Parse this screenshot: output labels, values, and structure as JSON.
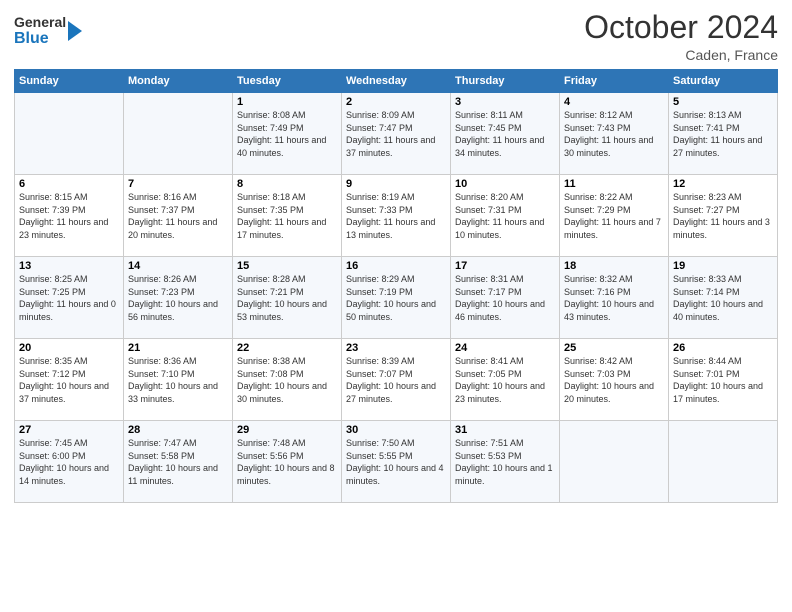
{
  "logo": {
    "line1": "General",
    "line2": "Blue"
  },
  "title": "October 2024",
  "location": "Caden, France",
  "weekdays": [
    "Sunday",
    "Monday",
    "Tuesday",
    "Wednesday",
    "Thursday",
    "Friday",
    "Saturday"
  ],
  "weeks": [
    [
      {
        "day": "",
        "sunrise": "",
        "sunset": "",
        "daylight": ""
      },
      {
        "day": "",
        "sunrise": "",
        "sunset": "",
        "daylight": ""
      },
      {
        "day": "1",
        "sunrise": "Sunrise: 8:08 AM",
        "sunset": "Sunset: 7:49 PM",
        "daylight": "Daylight: 11 hours and 40 minutes."
      },
      {
        "day": "2",
        "sunrise": "Sunrise: 8:09 AM",
        "sunset": "Sunset: 7:47 PM",
        "daylight": "Daylight: 11 hours and 37 minutes."
      },
      {
        "day": "3",
        "sunrise": "Sunrise: 8:11 AM",
        "sunset": "Sunset: 7:45 PM",
        "daylight": "Daylight: 11 hours and 34 minutes."
      },
      {
        "day": "4",
        "sunrise": "Sunrise: 8:12 AM",
        "sunset": "Sunset: 7:43 PM",
        "daylight": "Daylight: 11 hours and 30 minutes."
      },
      {
        "day": "5",
        "sunrise": "Sunrise: 8:13 AM",
        "sunset": "Sunset: 7:41 PM",
        "daylight": "Daylight: 11 hours and 27 minutes."
      }
    ],
    [
      {
        "day": "6",
        "sunrise": "Sunrise: 8:15 AM",
        "sunset": "Sunset: 7:39 PM",
        "daylight": "Daylight: 11 hours and 23 minutes."
      },
      {
        "day": "7",
        "sunrise": "Sunrise: 8:16 AM",
        "sunset": "Sunset: 7:37 PM",
        "daylight": "Daylight: 11 hours and 20 minutes."
      },
      {
        "day": "8",
        "sunrise": "Sunrise: 8:18 AM",
        "sunset": "Sunset: 7:35 PM",
        "daylight": "Daylight: 11 hours and 17 minutes."
      },
      {
        "day": "9",
        "sunrise": "Sunrise: 8:19 AM",
        "sunset": "Sunset: 7:33 PM",
        "daylight": "Daylight: 11 hours and 13 minutes."
      },
      {
        "day": "10",
        "sunrise": "Sunrise: 8:20 AM",
        "sunset": "Sunset: 7:31 PM",
        "daylight": "Daylight: 11 hours and 10 minutes."
      },
      {
        "day": "11",
        "sunrise": "Sunrise: 8:22 AM",
        "sunset": "Sunset: 7:29 PM",
        "daylight": "Daylight: 11 hours and 7 minutes."
      },
      {
        "day": "12",
        "sunrise": "Sunrise: 8:23 AM",
        "sunset": "Sunset: 7:27 PM",
        "daylight": "Daylight: 11 hours and 3 minutes."
      }
    ],
    [
      {
        "day": "13",
        "sunrise": "Sunrise: 8:25 AM",
        "sunset": "Sunset: 7:25 PM",
        "daylight": "Daylight: 11 hours and 0 minutes."
      },
      {
        "day": "14",
        "sunrise": "Sunrise: 8:26 AM",
        "sunset": "Sunset: 7:23 PM",
        "daylight": "Daylight: 10 hours and 56 minutes."
      },
      {
        "day": "15",
        "sunrise": "Sunrise: 8:28 AM",
        "sunset": "Sunset: 7:21 PM",
        "daylight": "Daylight: 10 hours and 53 minutes."
      },
      {
        "day": "16",
        "sunrise": "Sunrise: 8:29 AM",
        "sunset": "Sunset: 7:19 PM",
        "daylight": "Daylight: 10 hours and 50 minutes."
      },
      {
        "day": "17",
        "sunrise": "Sunrise: 8:31 AM",
        "sunset": "Sunset: 7:17 PM",
        "daylight": "Daylight: 10 hours and 46 minutes."
      },
      {
        "day": "18",
        "sunrise": "Sunrise: 8:32 AM",
        "sunset": "Sunset: 7:16 PM",
        "daylight": "Daylight: 10 hours and 43 minutes."
      },
      {
        "day": "19",
        "sunrise": "Sunrise: 8:33 AM",
        "sunset": "Sunset: 7:14 PM",
        "daylight": "Daylight: 10 hours and 40 minutes."
      }
    ],
    [
      {
        "day": "20",
        "sunrise": "Sunrise: 8:35 AM",
        "sunset": "Sunset: 7:12 PM",
        "daylight": "Daylight: 10 hours and 37 minutes."
      },
      {
        "day": "21",
        "sunrise": "Sunrise: 8:36 AM",
        "sunset": "Sunset: 7:10 PM",
        "daylight": "Daylight: 10 hours and 33 minutes."
      },
      {
        "day": "22",
        "sunrise": "Sunrise: 8:38 AM",
        "sunset": "Sunset: 7:08 PM",
        "daylight": "Daylight: 10 hours and 30 minutes."
      },
      {
        "day": "23",
        "sunrise": "Sunrise: 8:39 AM",
        "sunset": "Sunset: 7:07 PM",
        "daylight": "Daylight: 10 hours and 27 minutes."
      },
      {
        "day": "24",
        "sunrise": "Sunrise: 8:41 AM",
        "sunset": "Sunset: 7:05 PM",
        "daylight": "Daylight: 10 hours and 23 minutes."
      },
      {
        "day": "25",
        "sunrise": "Sunrise: 8:42 AM",
        "sunset": "Sunset: 7:03 PM",
        "daylight": "Daylight: 10 hours and 20 minutes."
      },
      {
        "day": "26",
        "sunrise": "Sunrise: 8:44 AM",
        "sunset": "Sunset: 7:01 PM",
        "daylight": "Daylight: 10 hours and 17 minutes."
      }
    ],
    [
      {
        "day": "27",
        "sunrise": "Sunrise: 7:45 AM",
        "sunset": "Sunset: 6:00 PM",
        "daylight": "Daylight: 10 hours and 14 minutes."
      },
      {
        "day": "28",
        "sunrise": "Sunrise: 7:47 AM",
        "sunset": "Sunset: 5:58 PM",
        "daylight": "Daylight: 10 hours and 11 minutes."
      },
      {
        "day": "29",
        "sunrise": "Sunrise: 7:48 AM",
        "sunset": "Sunset: 5:56 PM",
        "daylight": "Daylight: 10 hours and 8 minutes."
      },
      {
        "day": "30",
        "sunrise": "Sunrise: 7:50 AM",
        "sunset": "Sunset: 5:55 PM",
        "daylight": "Daylight: 10 hours and 4 minutes."
      },
      {
        "day": "31",
        "sunrise": "Sunrise: 7:51 AM",
        "sunset": "Sunset: 5:53 PM",
        "daylight": "Daylight: 10 hours and 1 minute."
      },
      {
        "day": "",
        "sunrise": "",
        "sunset": "",
        "daylight": ""
      },
      {
        "day": "",
        "sunrise": "",
        "sunset": "",
        "daylight": ""
      }
    ]
  ]
}
